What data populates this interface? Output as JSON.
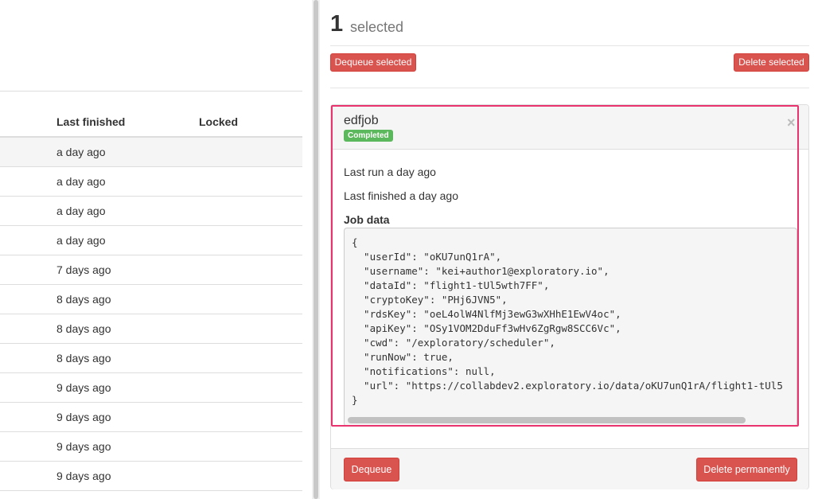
{
  "table": {
    "headers": {
      "last_finished": "Last finished",
      "locked": "Locked"
    },
    "rows": [
      {
        "last_finished": "a day ago",
        "locked": ""
      },
      {
        "last_finished": "a day ago",
        "locked": ""
      },
      {
        "last_finished": "a day ago",
        "locked": ""
      },
      {
        "last_finished": "a day ago",
        "locked": ""
      },
      {
        "last_finished": "7 days ago",
        "locked": ""
      },
      {
        "last_finished": "8 days ago",
        "locked": ""
      },
      {
        "last_finished": "8 days ago",
        "locked": ""
      },
      {
        "last_finished": "8 days ago",
        "locked": ""
      },
      {
        "last_finished": "9 days ago",
        "locked": ""
      },
      {
        "last_finished": "9 days ago",
        "locked": ""
      },
      {
        "last_finished": "9 days ago",
        "locked": ""
      },
      {
        "last_finished": "9 days ago",
        "locked": ""
      }
    ]
  },
  "selection": {
    "count": "1",
    "label": "selected",
    "dequeue_selected": "Dequeue selected",
    "delete_selected": "Delete selected"
  },
  "job": {
    "name": "edfjob",
    "status": "Completed",
    "close_glyph": "×",
    "last_run": "Last run a day ago",
    "last_finished": "Last finished a day ago",
    "job_data_label": "Job data",
    "job_data_text": "{\n  \"userId\": \"oKU7unQ1rA\",\n  \"username\": \"kei+author1@exploratory.io\",\n  \"dataId\": \"flight1-tUl5wth7FF\",\n  \"cryptoKey\": \"PHj6JVN5\",\n  \"rdsKey\": \"oeL4olW4NlfMj3ewG3wXHhE1EwV4oc\",\n  \"apiKey\": \"OSy1VOM2DduFf3wHv6ZgRgw8SCC6Vc\",\n  \"cwd\": \"/exploratory/scheduler\",\n  \"runNow\": true,\n  \"notifications\": null,\n  \"url\": \"https://collabdev2.exploratory.io/data/oKU7unQ1rA/flight1-tUl5\n}",
    "dequeue": "Dequeue",
    "delete_permanently": "Delete permanently"
  },
  "colors": {
    "danger": "#d9534f",
    "success": "#5cb85c",
    "highlight": "#e8336e"
  },
  "icons": {
    "close": "close-icon"
  }
}
